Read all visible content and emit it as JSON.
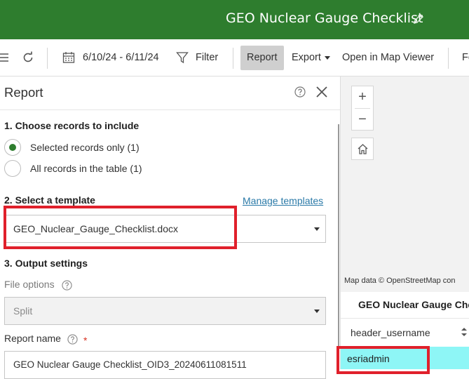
{
  "header": {
    "title": "GEO Nuclear Gauge Checklist",
    "edit_icon": "pencil-icon",
    "color": "#2e7d2e"
  },
  "toolbar": {
    "date_range": "6/10/24 - 6/11/24",
    "filter_label": "Filter",
    "report_label": "Report",
    "export_label": "Export",
    "open_map_label": "Open in Map Viewer",
    "cut_off_label": "Fe"
  },
  "panel": {
    "title": "Report",
    "section1": "1. Choose records to include",
    "radio_selected": "Selected records only (1)",
    "radio_all": "All records in the table (1)",
    "section2": "2. Select a template",
    "manage_templates": "Manage templates",
    "template_value": "GEO_Nuclear_Gauge_Checklist.docx",
    "section3": "3. Output settings",
    "file_options_label": "File options",
    "file_options_value": "Split",
    "report_name_label": "Report name",
    "required_mark": "*",
    "report_name_value": "GEO Nuclear Gauge Checklist_OID3_20240611081511"
  },
  "map": {
    "zoom_in": "+",
    "zoom_out": "−",
    "attribution": "Map data © OpenStreetMap con"
  },
  "table": {
    "title": "GEO Nuclear Gauge Che",
    "column_header": "header_username",
    "rows": [
      {
        "value": "esriadmin"
      }
    ],
    "highlight_color": "#8ef6f6"
  },
  "annotation_color": "#e0202b"
}
